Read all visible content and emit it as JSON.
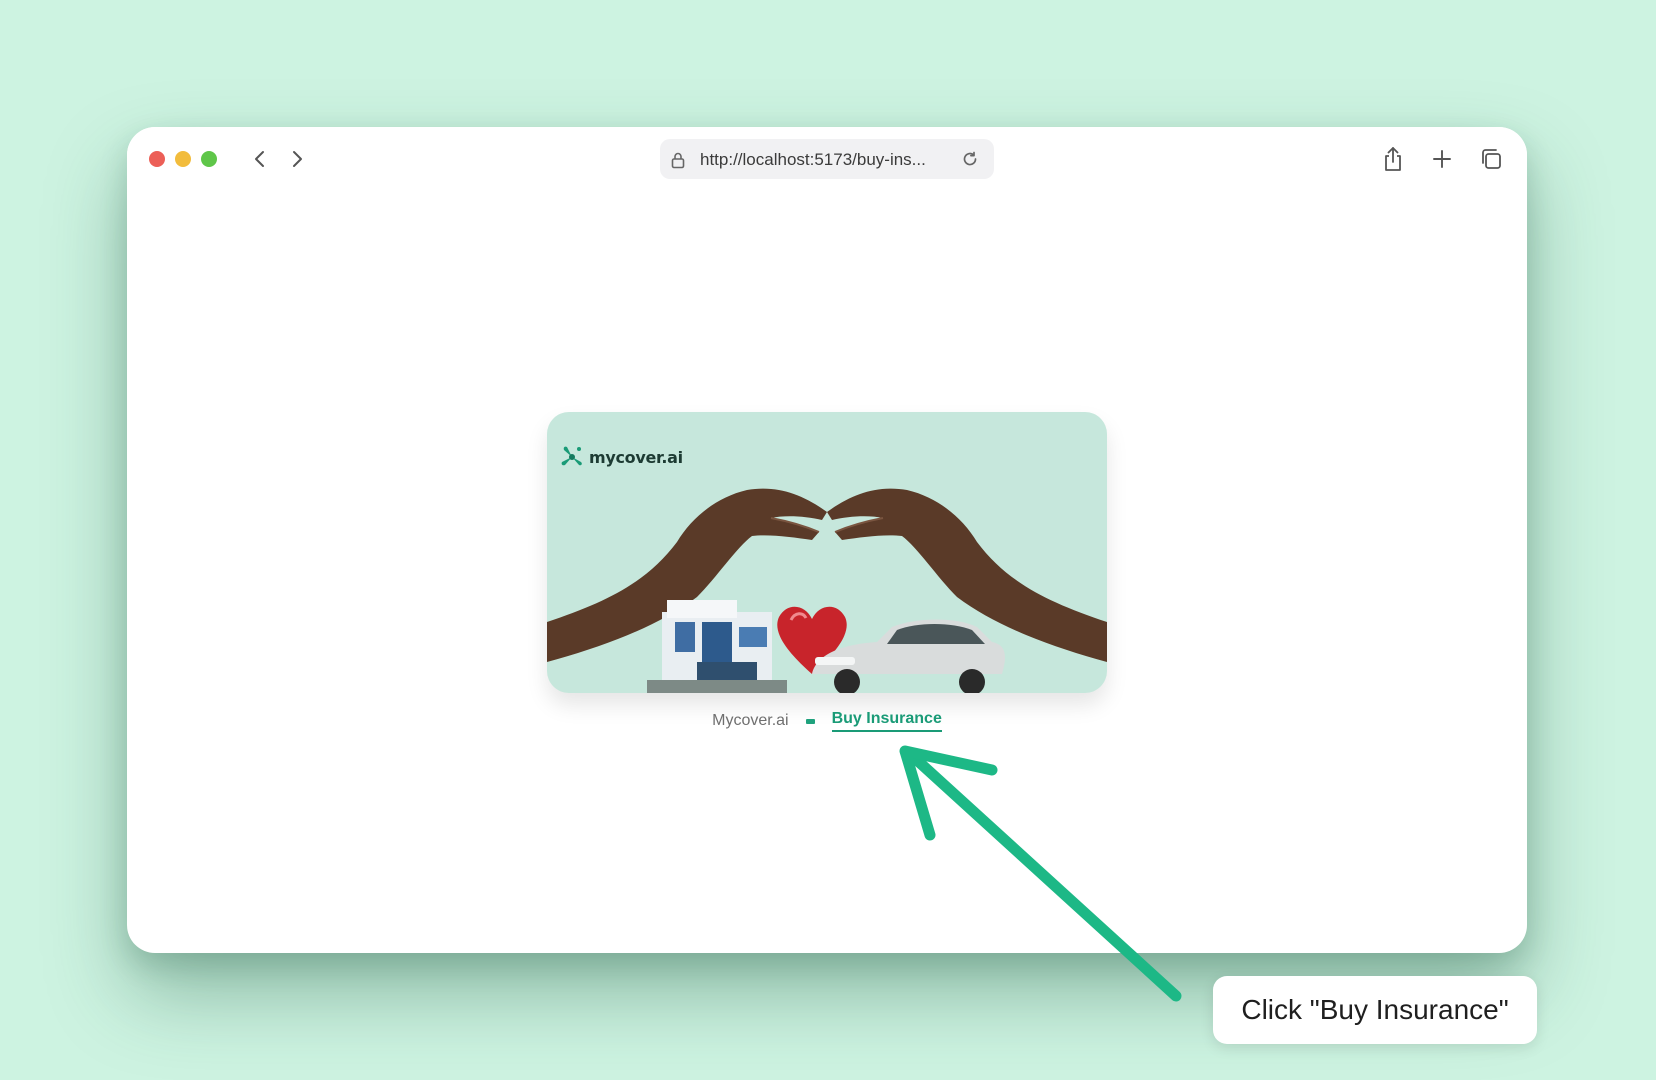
{
  "browser": {
    "url": "http://localhost:5173/buy-ins...",
    "icons": [
      "close-icon",
      "minimize-icon",
      "maximize-icon",
      "back-icon",
      "forward-icon",
      "lock-icon",
      "reload-icon",
      "share-icon",
      "new-tab-icon",
      "tabs-overview-icon"
    ]
  },
  "page": {
    "banner_logo": "mycover.ai",
    "breadcrumb": {
      "home": "Mycover.ai",
      "current": "Buy Insurance"
    }
  },
  "annotation": {
    "callout_text": "Click \"Buy Insurance\"",
    "arrow_color": "#1db886"
  },
  "colors": {
    "background": "#cdf3e1",
    "accent": "#1a9b77",
    "banner_bg": "#c6e7dc"
  }
}
